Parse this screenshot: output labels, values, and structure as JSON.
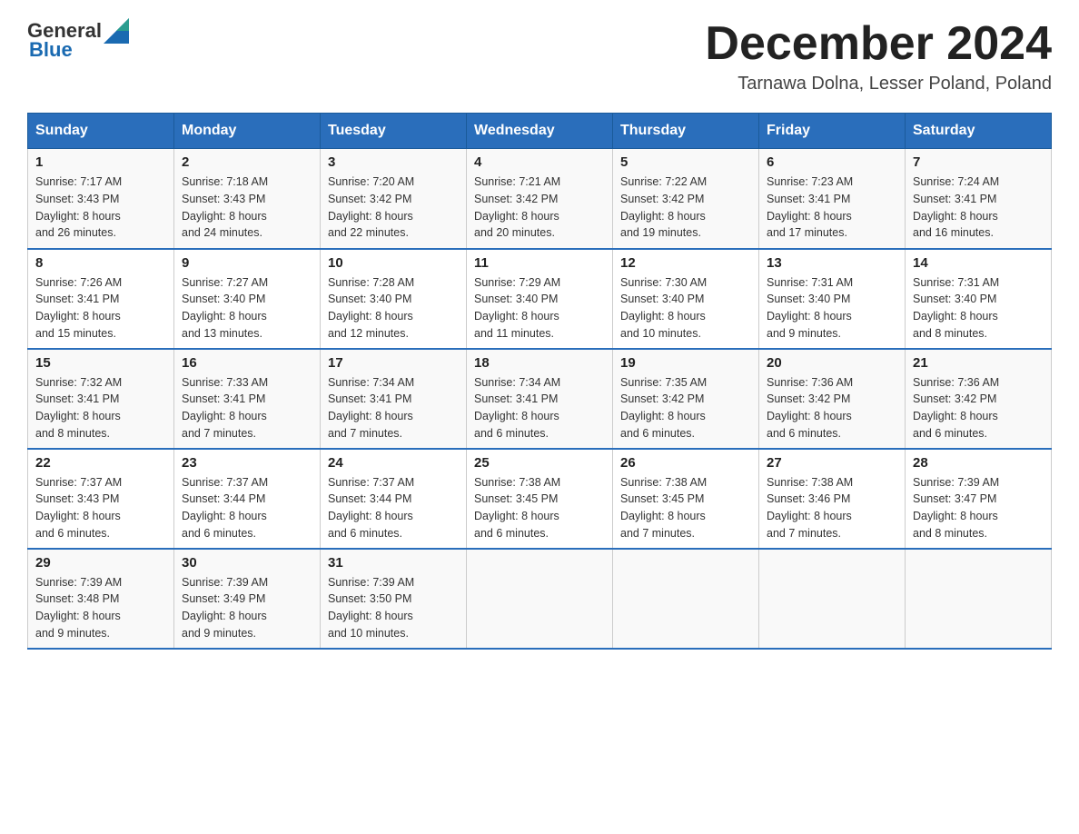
{
  "header": {
    "logo_general": "General",
    "logo_blue": "Blue",
    "title": "December 2024",
    "subtitle": "Tarnawa Dolna, Lesser Poland, Poland"
  },
  "days_of_week": [
    "Sunday",
    "Monday",
    "Tuesday",
    "Wednesday",
    "Thursday",
    "Friday",
    "Saturday"
  ],
  "weeks": [
    [
      {
        "day": "1",
        "sunrise": "7:17 AM",
        "sunset": "3:43 PM",
        "daylight": "8 hours and 26 minutes."
      },
      {
        "day": "2",
        "sunrise": "7:18 AM",
        "sunset": "3:43 PM",
        "daylight": "8 hours and 24 minutes."
      },
      {
        "day": "3",
        "sunrise": "7:20 AM",
        "sunset": "3:42 PM",
        "daylight": "8 hours and 22 minutes."
      },
      {
        "day": "4",
        "sunrise": "7:21 AM",
        "sunset": "3:42 PM",
        "daylight": "8 hours and 20 minutes."
      },
      {
        "day": "5",
        "sunrise": "7:22 AM",
        "sunset": "3:42 PM",
        "daylight": "8 hours and 19 minutes."
      },
      {
        "day": "6",
        "sunrise": "7:23 AM",
        "sunset": "3:41 PM",
        "daylight": "8 hours and 17 minutes."
      },
      {
        "day": "7",
        "sunrise": "7:24 AM",
        "sunset": "3:41 PM",
        "daylight": "8 hours and 16 minutes."
      }
    ],
    [
      {
        "day": "8",
        "sunrise": "7:26 AM",
        "sunset": "3:41 PM",
        "daylight": "8 hours and 15 minutes."
      },
      {
        "day": "9",
        "sunrise": "7:27 AM",
        "sunset": "3:40 PM",
        "daylight": "8 hours and 13 minutes."
      },
      {
        "day": "10",
        "sunrise": "7:28 AM",
        "sunset": "3:40 PM",
        "daylight": "8 hours and 12 minutes."
      },
      {
        "day": "11",
        "sunrise": "7:29 AM",
        "sunset": "3:40 PM",
        "daylight": "8 hours and 11 minutes."
      },
      {
        "day": "12",
        "sunrise": "7:30 AM",
        "sunset": "3:40 PM",
        "daylight": "8 hours and 10 minutes."
      },
      {
        "day": "13",
        "sunrise": "7:31 AM",
        "sunset": "3:40 PM",
        "daylight": "8 hours and 9 minutes."
      },
      {
        "day": "14",
        "sunrise": "7:31 AM",
        "sunset": "3:40 PM",
        "daylight": "8 hours and 8 minutes."
      }
    ],
    [
      {
        "day": "15",
        "sunrise": "7:32 AM",
        "sunset": "3:41 PM",
        "daylight": "8 hours and 8 minutes."
      },
      {
        "day": "16",
        "sunrise": "7:33 AM",
        "sunset": "3:41 PM",
        "daylight": "8 hours and 7 minutes."
      },
      {
        "day": "17",
        "sunrise": "7:34 AM",
        "sunset": "3:41 PM",
        "daylight": "8 hours and 7 minutes."
      },
      {
        "day": "18",
        "sunrise": "7:34 AM",
        "sunset": "3:41 PM",
        "daylight": "8 hours and 6 minutes."
      },
      {
        "day": "19",
        "sunrise": "7:35 AM",
        "sunset": "3:42 PM",
        "daylight": "8 hours and 6 minutes."
      },
      {
        "day": "20",
        "sunrise": "7:36 AM",
        "sunset": "3:42 PM",
        "daylight": "8 hours and 6 minutes."
      },
      {
        "day": "21",
        "sunrise": "7:36 AM",
        "sunset": "3:42 PM",
        "daylight": "8 hours and 6 minutes."
      }
    ],
    [
      {
        "day": "22",
        "sunrise": "7:37 AM",
        "sunset": "3:43 PM",
        "daylight": "8 hours and 6 minutes."
      },
      {
        "day": "23",
        "sunrise": "7:37 AM",
        "sunset": "3:44 PM",
        "daylight": "8 hours and 6 minutes."
      },
      {
        "day": "24",
        "sunrise": "7:37 AM",
        "sunset": "3:44 PM",
        "daylight": "8 hours and 6 minutes."
      },
      {
        "day": "25",
        "sunrise": "7:38 AM",
        "sunset": "3:45 PM",
        "daylight": "8 hours and 6 minutes."
      },
      {
        "day": "26",
        "sunrise": "7:38 AM",
        "sunset": "3:45 PM",
        "daylight": "8 hours and 7 minutes."
      },
      {
        "day": "27",
        "sunrise": "7:38 AM",
        "sunset": "3:46 PM",
        "daylight": "8 hours and 7 minutes."
      },
      {
        "day": "28",
        "sunrise": "7:39 AM",
        "sunset": "3:47 PM",
        "daylight": "8 hours and 8 minutes."
      }
    ],
    [
      {
        "day": "29",
        "sunrise": "7:39 AM",
        "sunset": "3:48 PM",
        "daylight": "8 hours and 9 minutes."
      },
      {
        "day": "30",
        "sunrise": "7:39 AM",
        "sunset": "3:49 PM",
        "daylight": "8 hours and 9 minutes."
      },
      {
        "day": "31",
        "sunrise": "7:39 AM",
        "sunset": "3:50 PM",
        "daylight": "8 hours and 10 minutes."
      },
      null,
      null,
      null,
      null
    ]
  ],
  "labels": {
    "sunrise": "Sunrise:",
    "sunset": "Sunset:",
    "daylight": "Daylight:"
  }
}
